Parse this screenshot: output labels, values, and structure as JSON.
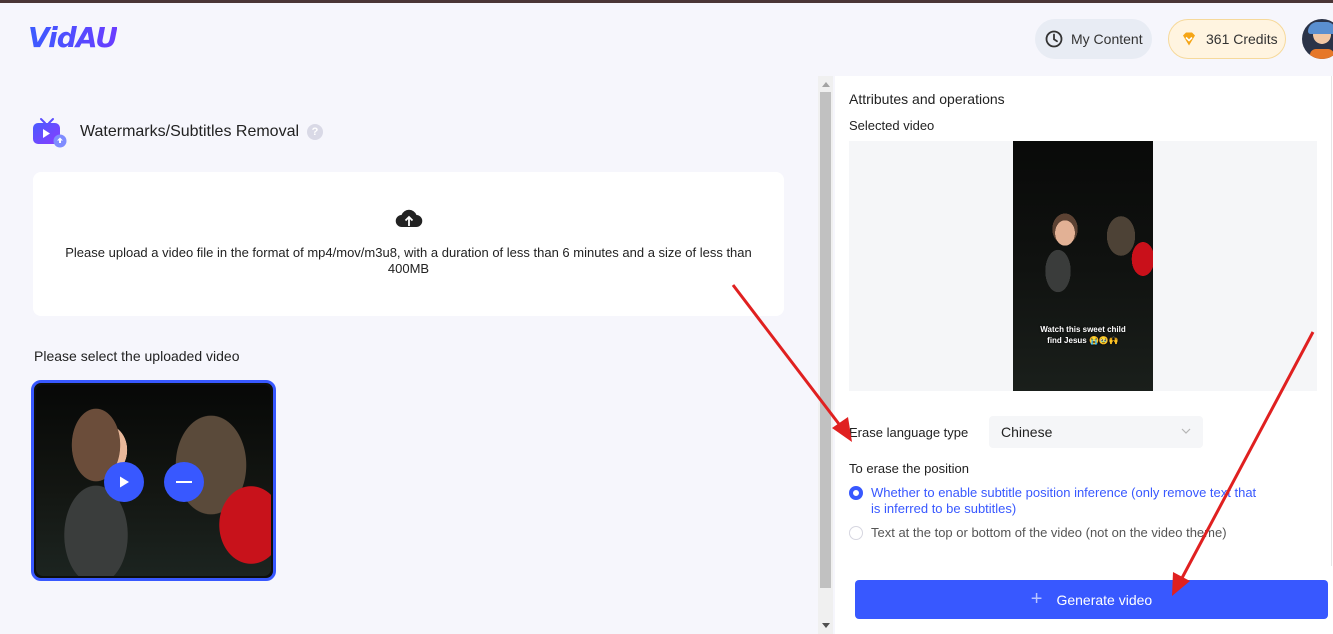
{
  "header": {
    "logo": "VidAU",
    "my_content_label": "My Content",
    "credits_label": "361 Credits",
    "brand_color": "#3858ff"
  },
  "tool": {
    "title": "Watermarks/Subtitles Removal",
    "help": "?"
  },
  "upload": {
    "instructions": "Please upload a video file in the format of mp4/mov/m3u8, with a duration of less than 6 minutes and a size of less than 400MB"
  },
  "uploaded": {
    "label": "Please select the uploaded video"
  },
  "panel": {
    "title": "Attributes and operations",
    "selected_video_label": "Selected video",
    "video_caption_line1": "Watch this sweet child",
    "video_caption_line2": "find Jesus 😭🥹🙌",
    "erase_language_label": "Erase language type",
    "erase_language_value": "Chinese",
    "erase_position_label": "To erase the position",
    "position_options": [
      {
        "label": "Whether to enable subtitle position inference (only remove text that is inferred to be subtitles)",
        "selected": true
      },
      {
        "label": "Text at the top or bottom of the video (not on the video theme)",
        "selected": false
      }
    ],
    "generate_label": "Generate video"
  },
  "annotation_color": "#e02020"
}
